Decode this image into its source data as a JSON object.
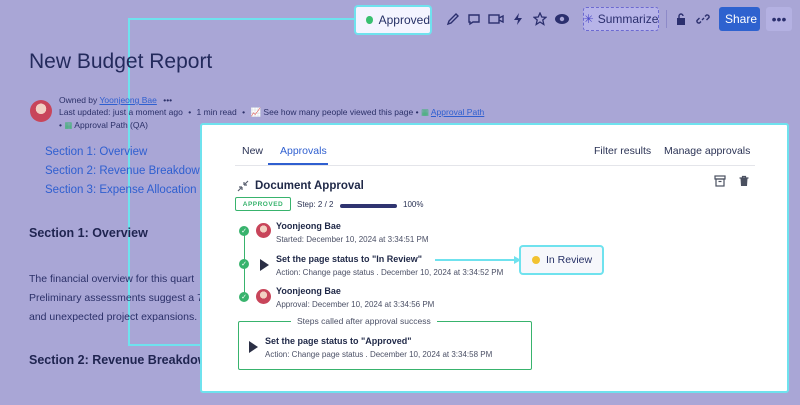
{
  "toolbar": {
    "status_label": "Approved",
    "summarize_label": "Summarize",
    "share_label": "Share",
    "more_label": "•••",
    "icons": [
      "edit-icon",
      "comment-icon",
      "video-icon",
      "lightning-icon",
      "star-icon",
      "watch-icon",
      "summarize-icon",
      "restrictions-icon",
      "link-icon"
    ]
  },
  "page": {
    "title": "New Budget Report",
    "owner_prefix": "Owned by",
    "owner_name": "Yoonjeong Bae",
    "owner_more": "•••",
    "last_updated": "Last updated: just a moment ago",
    "read_time": "1 min read",
    "views_text": "See how many people viewed this page",
    "approval_path_link": "Approval Path",
    "approval_path_qa": "Approval Path (QA)",
    "toc": [
      "Section 1: Overview",
      "Section 2: Revenue Breakdown",
      "Section 3: Expense Allocation"
    ],
    "section1_heading": "Section 1: Overview",
    "para_lines": [
      "The financial overview for this quart",
      "Preliminary assessments suggest a 7",
      "and unexpected project expansions."
    ],
    "section2_heading": "Section 2: Revenue Breakdow"
  },
  "panel": {
    "tabs": [
      "New",
      "Approvals"
    ],
    "filter_label": "Filter results",
    "manage_label": "Manage approvals",
    "title": "Document Approval",
    "badge": "APPROVED",
    "step_text": "Step: 2 / 2",
    "progress_percent": "100%",
    "progress_fraction": 1.0,
    "steps": [
      {
        "name": "Yoonjeong Bae",
        "sub": "Started: December 10, 2024 at 3:34:51 PM"
      },
      {
        "name": "Set the page status to \"In Review\"",
        "sub": "Action: Change page status . December 10, 2024 at 3:34:52 PM"
      },
      {
        "name": "Yoonjeong Bae",
        "sub": "Approval: December 10, 2024 at 3:34:56 PM"
      }
    ],
    "after_label": "Steps called after approval success",
    "after_step": {
      "name": "Set the page status to \"Approved\"",
      "sub": "Action: Change page status .  December 10, 2024 at 3:34:58 PM"
    },
    "in_review_label": "In Review"
  },
  "colors": {
    "accent": "#2f5fd0",
    "highlight": "#6fe2ee",
    "success": "#38b36d",
    "status_yellow": "#f2c230"
  }
}
